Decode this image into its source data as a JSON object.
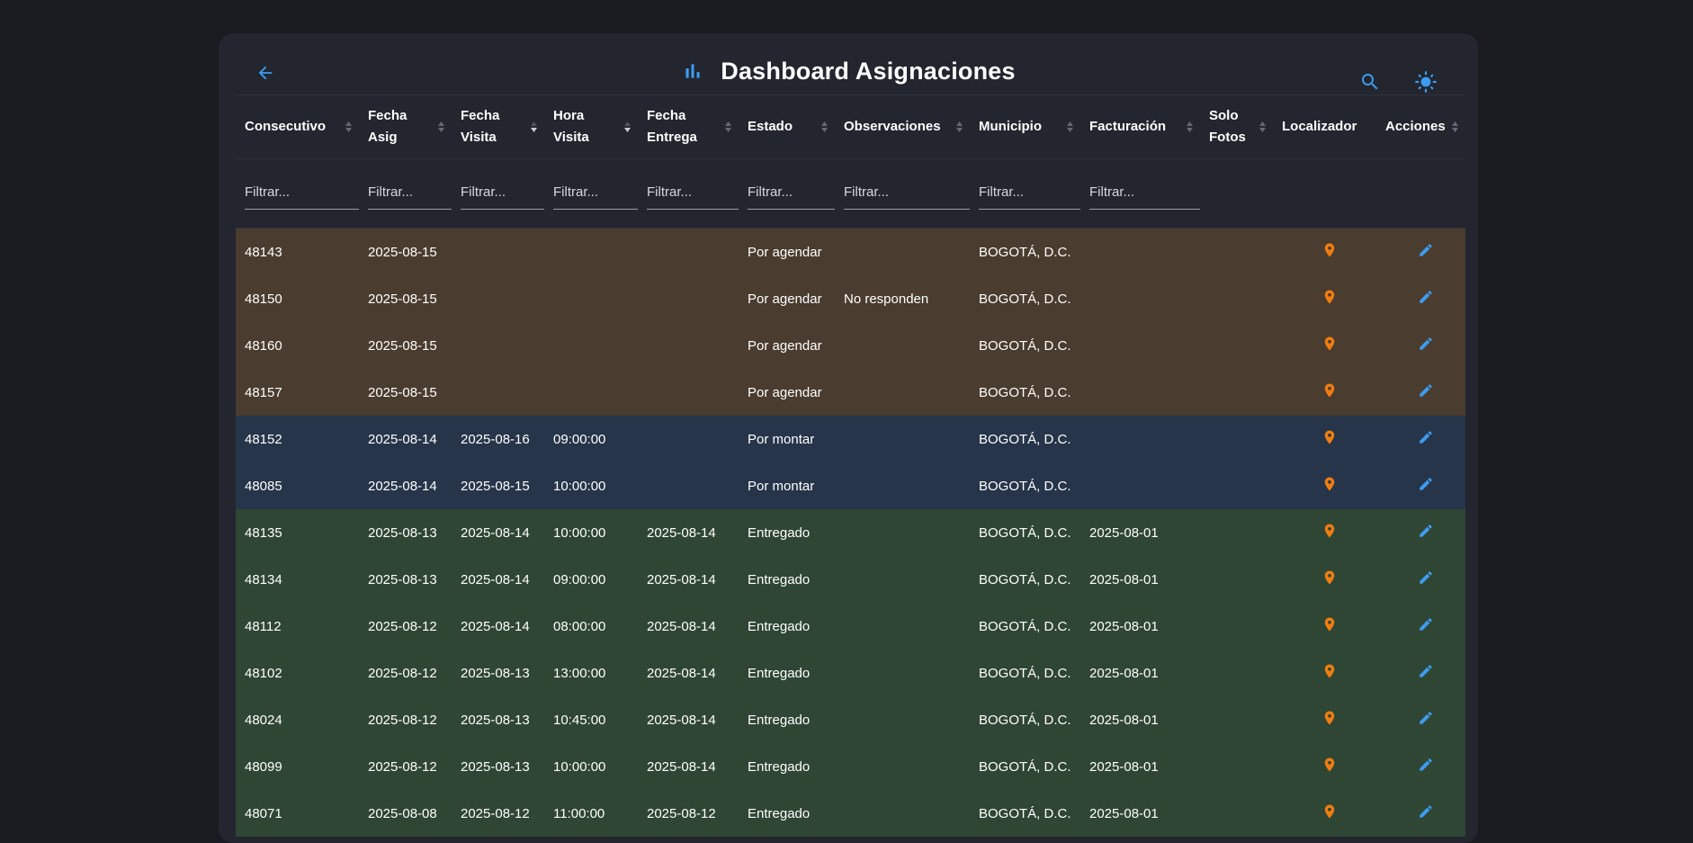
{
  "header": {
    "title": "Dashboard Asignaciones",
    "accent_color": "#3d9cf0",
    "icons": {
      "back": "arrow-back-icon",
      "title": "bar-chart-icon",
      "search": "search-icon",
      "theme": "sun-icon"
    }
  },
  "columns": [
    {
      "line1": "Consecutivo",
      "line2": ""
    },
    {
      "line1": "Fecha",
      "line2": "Asig"
    },
    {
      "line1": "Fecha",
      "line2": "Visita"
    },
    {
      "line1": "Hora",
      "line2": "Visita"
    },
    {
      "line1": "Fecha",
      "line2": "Entrega"
    },
    {
      "line1": "Estado",
      "line2": ""
    },
    {
      "line1": "Observaciones",
      "line2": ""
    },
    {
      "line1": "Municipio",
      "line2": ""
    },
    {
      "line1": "Facturación",
      "line2": ""
    },
    {
      "line1": "Solo",
      "line2": "Fotos"
    },
    {
      "line1": "Localizador",
      "line2": ""
    },
    {
      "line1": "Acciones",
      "line2": ""
    }
  ],
  "filter_placeholder": "Filtrar...",
  "row_colors": {
    "por_agendar": "#4a3c2e",
    "por_montar": "#263549",
    "entregado": "#2f4634"
  },
  "icon_colors": {
    "pin": "#f07d10",
    "edit": "#3d9cf0"
  },
  "rows": [
    {
      "consecutivo": "48143",
      "fecha_asig": "2025-08-15",
      "fecha_visita": "",
      "hora_visita": "",
      "fecha_entrega": "",
      "estado": "Por agendar",
      "observaciones": "",
      "municipio": "BOGOTÁ, D.C.",
      "facturacion": "",
      "solo_fotos": "",
      "group": "agendar"
    },
    {
      "consecutivo": "48150",
      "fecha_asig": "2025-08-15",
      "fecha_visita": "",
      "hora_visita": "",
      "fecha_entrega": "",
      "estado": "Por agendar",
      "observaciones": "No responden",
      "municipio": "BOGOTÁ, D.C.",
      "facturacion": "",
      "solo_fotos": "",
      "group": "agendar"
    },
    {
      "consecutivo": "48160",
      "fecha_asig": "2025-08-15",
      "fecha_visita": "",
      "hora_visita": "",
      "fecha_entrega": "",
      "estado": "Por agendar",
      "observaciones": "",
      "municipio": "BOGOTÁ, D.C.",
      "facturacion": "",
      "solo_fotos": "",
      "group": "agendar"
    },
    {
      "consecutivo": "48157",
      "fecha_asig": "2025-08-15",
      "fecha_visita": "",
      "hora_visita": "",
      "fecha_entrega": "",
      "estado": "Por agendar",
      "observaciones": "",
      "municipio": "BOGOTÁ, D.C.",
      "facturacion": "",
      "solo_fotos": "",
      "group": "agendar"
    },
    {
      "consecutivo": "48152",
      "fecha_asig": "2025-08-14",
      "fecha_visita": "2025-08-16",
      "hora_visita": "09:00:00",
      "fecha_entrega": "",
      "estado": "Por montar",
      "observaciones": "",
      "municipio": "BOGOTÁ, D.C.",
      "facturacion": "",
      "solo_fotos": "",
      "group": "montar"
    },
    {
      "consecutivo": "48085",
      "fecha_asig": "2025-08-14",
      "fecha_visita": "2025-08-15",
      "hora_visita": "10:00:00",
      "fecha_entrega": "",
      "estado": "Por montar",
      "observaciones": "",
      "municipio": "BOGOTÁ, D.C.",
      "facturacion": "",
      "solo_fotos": "",
      "group": "montar"
    },
    {
      "consecutivo": "48135",
      "fecha_asig": "2025-08-13",
      "fecha_visita": "2025-08-14",
      "hora_visita": "10:00:00",
      "fecha_entrega": "2025-08-14",
      "estado": "Entregado",
      "observaciones": "",
      "municipio": "BOGOTÁ, D.C.",
      "facturacion": "2025-08-01",
      "solo_fotos": "",
      "group": "entregado"
    },
    {
      "consecutivo": "48134",
      "fecha_asig": "2025-08-13",
      "fecha_visita": "2025-08-14",
      "hora_visita": "09:00:00",
      "fecha_entrega": "2025-08-14",
      "estado": "Entregado",
      "observaciones": "",
      "municipio": "BOGOTÁ, D.C.",
      "facturacion": "2025-08-01",
      "solo_fotos": "",
      "group": "entregado"
    },
    {
      "consecutivo": "48112",
      "fecha_asig": "2025-08-12",
      "fecha_visita": "2025-08-14",
      "hora_visita": "08:00:00",
      "fecha_entrega": "2025-08-14",
      "estado": "Entregado",
      "observaciones": "",
      "municipio": "BOGOTÁ, D.C.",
      "facturacion": "2025-08-01",
      "solo_fotos": "",
      "group": "entregado"
    },
    {
      "consecutivo": "48102",
      "fecha_asig": "2025-08-12",
      "fecha_visita": "2025-08-13",
      "hora_visita": "13:00:00",
      "fecha_entrega": "2025-08-14",
      "estado": "Entregado",
      "observaciones": "",
      "municipio": "BOGOTÁ, D.C.",
      "facturacion": "2025-08-01",
      "solo_fotos": "",
      "group": "entregado"
    },
    {
      "consecutivo": "48024",
      "fecha_asig": "2025-08-12",
      "fecha_visita": "2025-08-13",
      "hora_visita": "10:45:00",
      "fecha_entrega": "2025-08-14",
      "estado": "Entregado",
      "observaciones": "",
      "municipio": "BOGOTÁ, D.C.",
      "facturacion": "2025-08-01",
      "solo_fotos": "",
      "group": "entregado"
    },
    {
      "consecutivo": "48099",
      "fecha_asig": "2025-08-12",
      "fecha_visita": "2025-08-13",
      "hora_visita": "10:00:00",
      "fecha_entrega": "2025-08-14",
      "estado": "Entregado",
      "observaciones": "",
      "municipio": "BOGOTÁ, D.C.",
      "facturacion": "2025-08-01",
      "solo_fotos": "",
      "group": "entregado"
    },
    {
      "consecutivo": "48071",
      "fecha_asig": "2025-08-08",
      "fecha_visita": "2025-08-12",
      "hora_visita": "11:00:00",
      "fecha_entrega": "2025-08-12",
      "estado": "Entregado",
      "observaciones": "",
      "municipio": "BOGOTÁ, D.C.",
      "facturacion": "2025-08-01",
      "solo_fotos": "",
      "group": "entregado"
    }
  ]
}
